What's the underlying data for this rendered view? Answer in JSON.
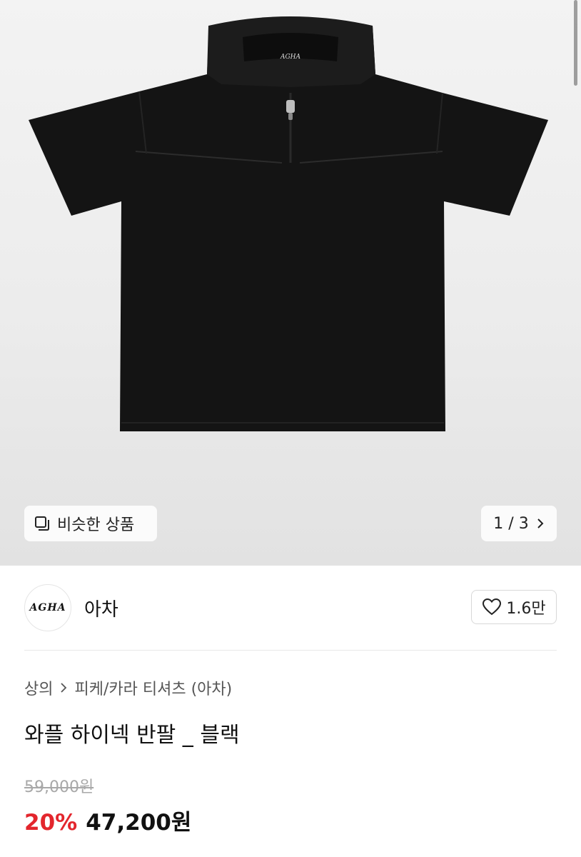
{
  "hero": {
    "image_alt": "와플 하이넥 반팔 _ 블랙",
    "similar_label": "비슷한 상품",
    "pager": "1 / 3"
  },
  "brand": {
    "logo_text": "AGHA",
    "name": "아차",
    "like_count": "1.6만"
  },
  "breadcrumb": {
    "category": "상의",
    "subcategory": "피케/카라 티셔츠 (아차)"
  },
  "product": {
    "title": "와플 하이넥 반팔 _ 블랙",
    "original_price": "59,000원",
    "discount": "20%",
    "sale_price": "47,200원"
  },
  "colors": {
    "discount": "#e3262d",
    "shirt": "#141414"
  },
  "icons": {
    "similar": "similar-products-icon",
    "pager_next": "chevron-right-icon",
    "like": "heart-icon",
    "breadcrumb_sep": "chevron-right-icon"
  }
}
